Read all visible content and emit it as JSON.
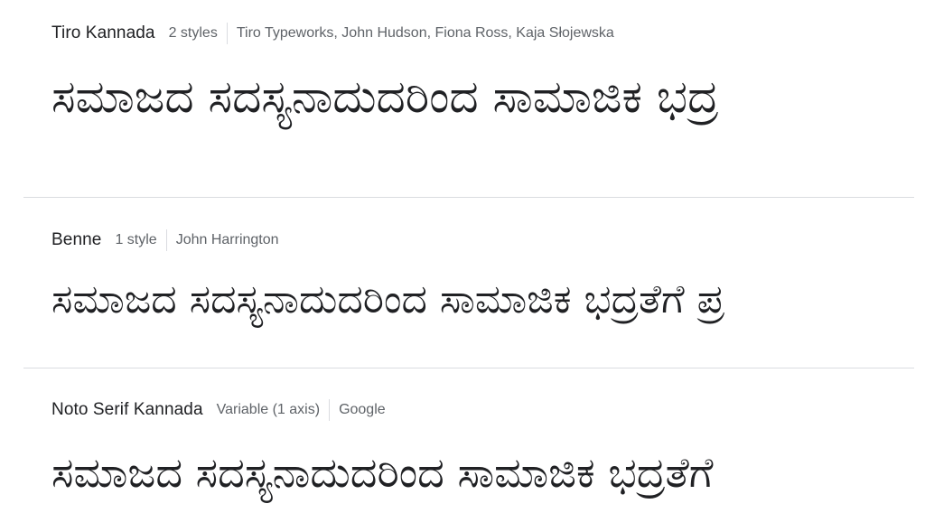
{
  "fonts": [
    {
      "family": "Tiro Kannada",
      "styles": "2 styles",
      "designers": "Tiro Typeworks, John Hudson, Fiona Ross, Kaja Słojewska",
      "sample": "ಸಮಾಜದ ಸದಸ್ಯನಾದುದರಿಂದ ಸಾಮಾಜಿಕ ಭದ್ರ"
    },
    {
      "family": "Benne",
      "styles": "1 style",
      "designers": "John Harrington",
      "sample": "ಸಮಾಜದ ಸದಸ್ಯನಾದುದರಿಂದ ಸಾಮಾಜಿಕ ಭದ್ರತೆಗೆ ಪ್ರ"
    },
    {
      "family": "Noto Serif Kannada",
      "styles": "Variable (1 axis)",
      "designers": "Google",
      "sample": "ಸಮಾಜದ ಸದಸ್ಯನಾದುದರಿಂದ ಸಾಮಾಜಿಕ ಭದ್ರತೆಗೆ"
    }
  ]
}
